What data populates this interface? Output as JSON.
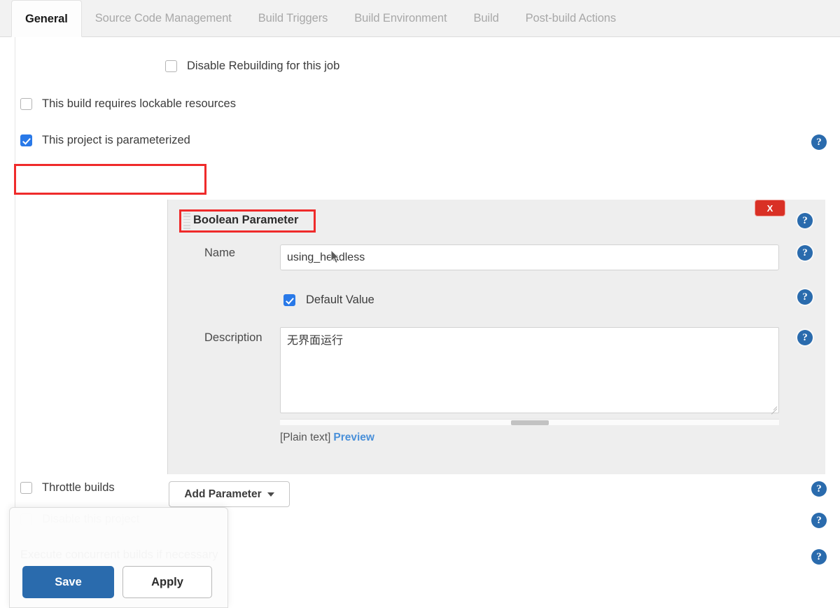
{
  "tabs": [
    {
      "label": "General",
      "active": true
    },
    {
      "label": "Source Code Management",
      "active": false
    },
    {
      "label": "Build Triggers",
      "active": false
    },
    {
      "label": "Build Environment",
      "active": false
    },
    {
      "label": "Build",
      "active": false
    },
    {
      "label": "Post-build Actions",
      "active": false
    }
  ],
  "options": {
    "disable_rebuilding": {
      "label": "Disable Rebuilding for this job",
      "checked": false
    },
    "lockable_resources": {
      "label": "This build requires lockable resources",
      "checked": false
    },
    "parameterized": {
      "label": "This project is parameterized",
      "checked": true,
      "highlighted": true
    },
    "throttle_builds": {
      "label": "Throttle builds",
      "checked": false
    },
    "disable_project": {
      "label": "Disable this project",
      "checked": false
    },
    "concurrent_builds": {
      "label": "Execute concurrent builds if necessary"
    }
  },
  "parameter": {
    "title": "Boolean Parameter",
    "title_highlighted": true,
    "close_label": "X",
    "name_label": "Name",
    "name_value": "using_headless",
    "name_placeholder": "",
    "default_value_label": "Default Value",
    "default_value_checked": true,
    "description_label": "Description",
    "description_value": "无界面运行",
    "description_placeholder": "",
    "markup_type": "[Plain text]",
    "preview_link": "Preview"
  },
  "add_parameter_button": "Add Parameter",
  "footer": {
    "save_label": "Save",
    "apply_label": "Apply"
  },
  "icons": {
    "help": "?"
  },
  "colors": {
    "accent_blue": "#2979e8",
    "button_blue": "#2a6bad",
    "danger_red": "#d93025",
    "highlight_red": "#ef2b2b",
    "link_blue": "#4a90d9",
    "panel_gray": "#eeeeee"
  }
}
